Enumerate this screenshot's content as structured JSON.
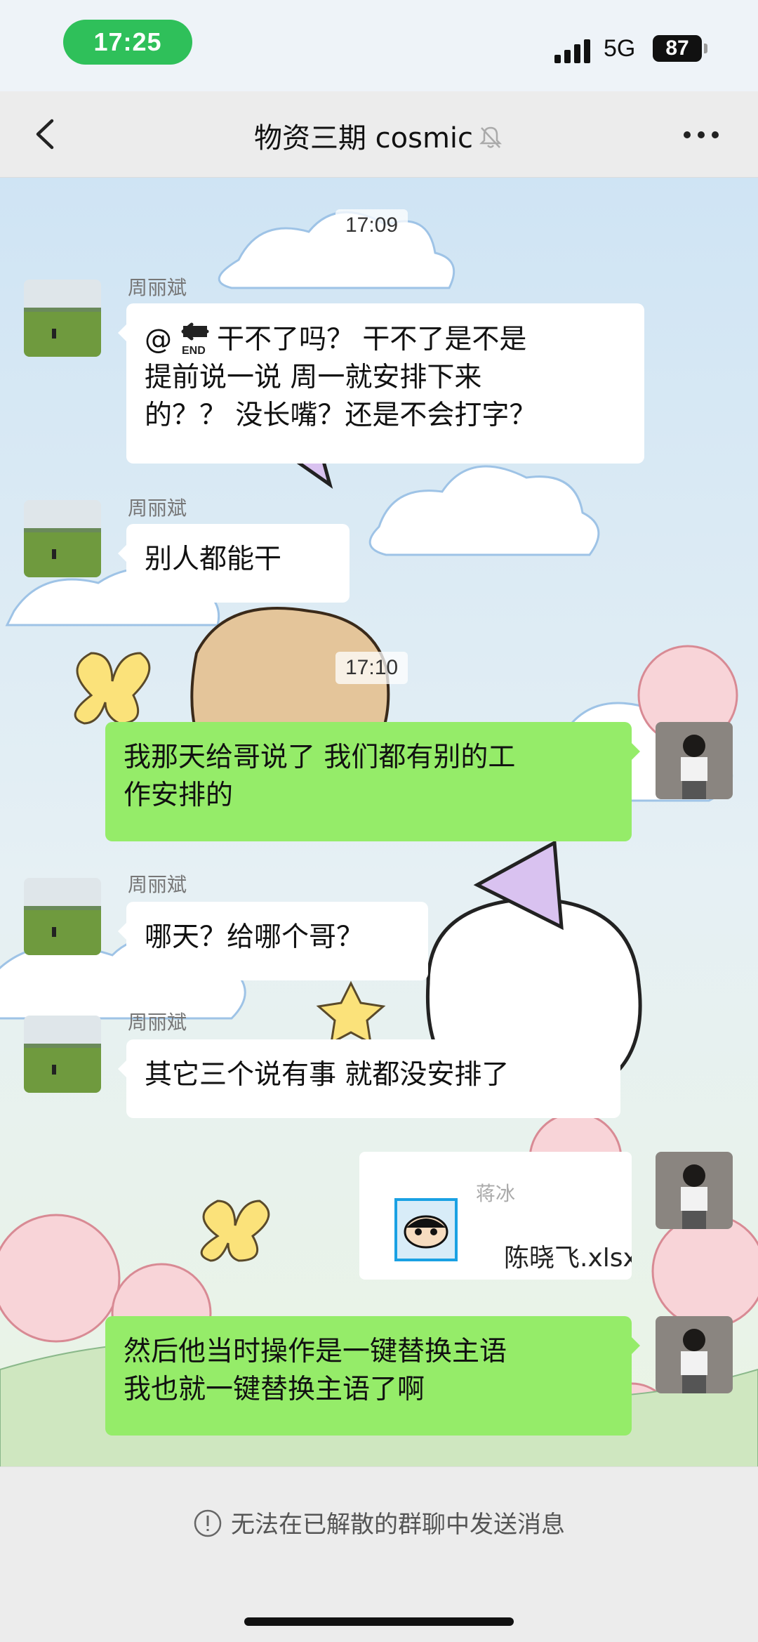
{
  "status_bar": {
    "time": "17:25",
    "network": "5G",
    "battery": "87"
  },
  "header": {
    "title": "物资三期 cosmic"
  },
  "messages": {
    "t1": "17:09",
    "m1": {
      "sender": "周丽斌",
      "line1": "干不了吗？ 干不了是不是",
      "line2": "提前说一说 周一就安排下来",
      "line3": "的？？ 没长嘴？还是不会打字？"
    },
    "m2": {
      "sender": "周丽斌",
      "text": "别人都能干"
    },
    "t2": "17:10",
    "m3": {
      "line1": "我那天给哥说了 我们都有别的工",
      "line2": "作安排的"
    },
    "m4": {
      "sender": "周丽斌",
      "text": "哪天？给哪个哥？"
    },
    "m5": {
      "sender": "周丽斌",
      "text": "其它三个说有事 就都没安排了"
    },
    "m6": {
      "file_sender": "蒋冰",
      "file_name": "陈晓飞.xlsx"
    },
    "m7": {
      "line1": "然后他当时操作是一键替换主语",
      "line2": "我也就一键替换主语了啊"
    }
  },
  "mention_label": "@",
  "footer": {
    "notice": "无法在已解散的群聊中发送消息"
  },
  "colors": {
    "bubble_out": "#95ec69",
    "bubble_in": "#ffffff",
    "time_pill": "#2fc05a",
    "nav_bg": "#ececec"
  }
}
